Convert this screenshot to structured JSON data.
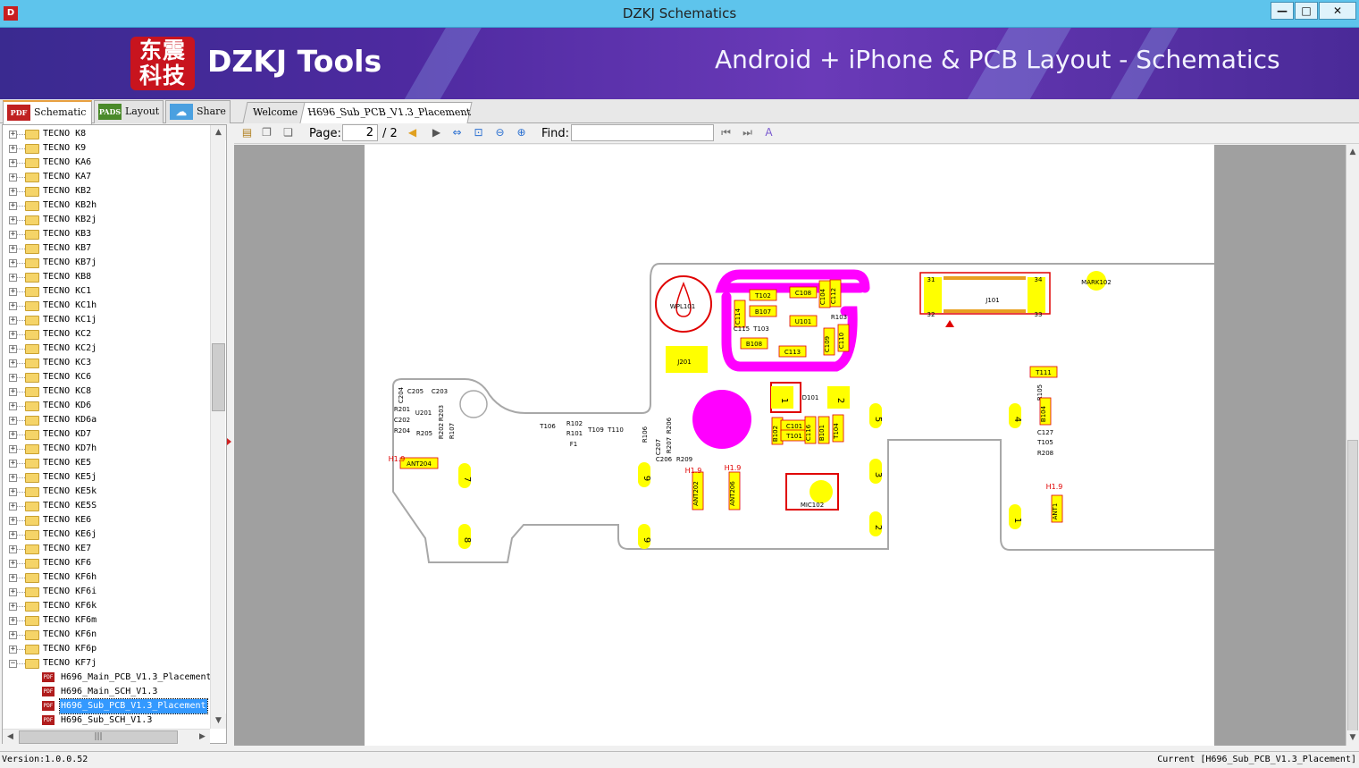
{
  "window": {
    "title": "DZKJ Schematics",
    "app_icon": "D",
    "minimize": "—",
    "maximize": "□",
    "close": "✕"
  },
  "banner": {
    "logo_line1": "东震",
    "logo_line2": "科技",
    "brand": "DZKJ Tools",
    "slogan": "Android + iPhone & PCB Layout - Schematics"
  },
  "left_tabs": [
    {
      "label": "Schematic",
      "icon": "PDF"
    },
    {
      "label": "Layout",
      "icon": "PADS"
    },
    {
      "label": "Share",
      "icon": "share"
    }
  ],
  "doc_tabs": [
    {
      "label": "Welcome"
    },
    {
      "label": "H696_Sub_PCB_V1.3_Placement"
    }
  ],
  "tree": {
    "folders": [
      "TECNO K8",
      "TECNO K9",
      "TECNO KA6",
      "TECNO KA7",
      "TECNO KB2",
      "TECNO KB2h",
      "TECNO KB2j",
      "TECNO KB3",
      "TECNO KB7",
      "TECNO KB7j",
      "TECNO KB8",
      "TECNO KC1",
      "TECNO KC1h",
      "TECNO KC1j",
      "TECNO KC2",
      "TECNO KC2j",
      "TECNO KC3",
      "TECNO KC6",
      "TECNO KC8",
      "TECNO KD6",
      "TECNO KD6a",
      "TECNO KD7",
      "TECNO KD7h",
      "TECNO KE5",
      "TECNO KE5j",
      "TECNO KE5k",
      "TECNO KE5S",
      "TECNO KE6",
      "TECNO KE6j",
      "TECNO KE7",
      "TECNO KF6",
      "TECNO KF6h",
      "TECNO KF6i",
      "TECNO KF6k",
      "TECNO KF6m",
      "TECNO KF6n",
      "TECNO KF6p",
      "TECNO KF7j"
    ],
    "files": [
      "H696_Main_PCB_V1.3_Placement",
      "H696_Main_SCH_V1.3",
      "H696_Sub_PCB_V1.3_Placement",
      "H696_Sub_SCH_V1.3"
    ],
    "selected_file": "H696_Sub_PCB_V1.3_Placement",
    "toggle_collapsed": "+",
    "toggle_expanded": "−",
    "file_icon": "PDF"
  },
  "toolbar": {
    "page_label": "Page:",
    "page_value": "2",
    "page_total": "/ 2",
    "find_label": "Find:",
    "find_value": ""
  },
  "pcb": {
    "labels": [
      "WPL101",
      "T102",
      "C108",
      "C112",
      "C104",
      "C114",
      "B107",
      "U101",
      "R103",
      "C115",
      "T103",
      "C109",
      "C110",
      "B108",
      "C113",
      "J101",
      "MARK102",
      "C204",
      "C205",
      "C203",
      "R201",
      "U201",
      "C202",
      "R203",
      "R202",
      "R204",
      "R205",
      "R107",
      "T106",
      "R102",
      "R101",
      "T109",
      "T110",
      "F1",
      "R106",
      "R206",
      "C207",
      "R207",
      "C206",
      "R209",
      "D101",
      "B102",
      "C101",
      "T101",
      "C116",
      "B101",
      "T104",
      "ANT204",
      "ANT202",
      "ANT206",
      "MIC102",
      "T111",
      "R105",
      "B104",
      "C127",
      "T105",
      "R208",
      "ANT1",
      "H1.9",
      "J201"
    ],
    "pad_numbers": [
      "31",
      "34",
      "32",
      "33",
      "1",
      "2",
      "3",
      "4",
      "5",
      "6",
      "7",
      "8",
      "9"
    ]
  },
  "status": {
    "version": "Version:1.0.0.52",
    "current": "Current [H696_Sub_PCB_V1.3_Placement]"
  },
  "colors": {
    "titlebar": "#5ec4ec",
    "banner": "#4e2aa0",
    "magenta": "#ff00ff",
    "pad_yellow": "#ffff00",
    "outline_red": "#e00000",
    "selection": "#3399ff"
  }
}
